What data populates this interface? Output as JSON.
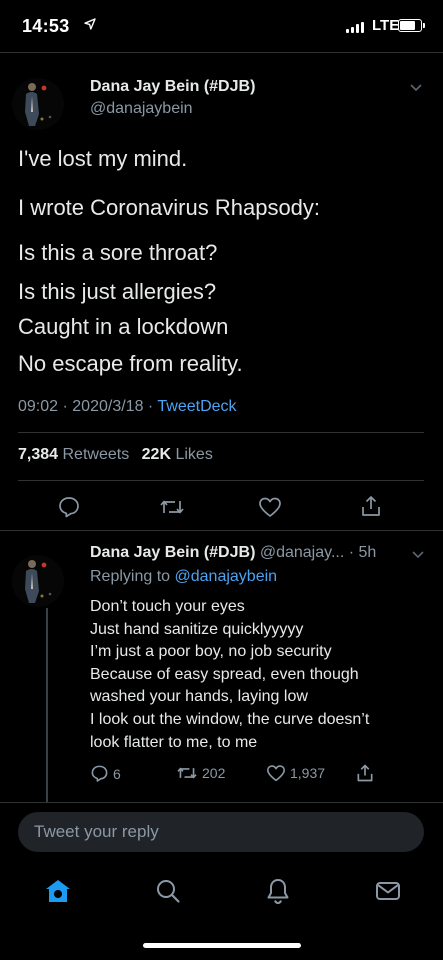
{
  "status_bar": {
    "time": "14:53",
    "network": "LTE",
    "battery_level": 0.8
  },
  "main_tweet": {
    "author_name": "Dana Jay Bein (#DJB)",
    "author_handle": "@danajaybein",
    "lines": [
      "I've lost my mind.",
      "I wrote Coronavirus Rhapsody:",
      "Is this a sore throat?",
      "Is this just allergies?",
      "Caught in a lockdown",
      "No escape from reality."
    ],
    "time": "09:02",
    "date": "2020/3/18",
    "separator": "·",
    "source": "TweetDeck",
    "retweets_count": "7,384",
    "retweets_label": "Retweets",
    "likes_count": "22K",
    "likes_label": "Likes"
  },
  "reply_tweet": {
    "author_name": "Dana Jay Bein (#DJB)",
    "author_handle": "@danajay...",
    "time_ago": "· 5h",
    "replying_to_label": "Replying to",
    "replying_to_handle": "@danajaybein",
    "lines": [
      "Don’t touch your eyes",
      "Just hand sanitize quicklyyyyy",
      "I’m just a poor boy, no job security",
      "Because of easy spread, even though",
      "washed your hands, laying low",
      "I look out the window, the curve doesn’t",
      "look flatter to me, to me"
    ],
    "reply_count": "6",
    "retweet_count": "202",
    "like_count": "1,937"
  },
  "compose": {
    "placeholder": "Tweet your reply"
  },
  "tab_bar": {
    "active": "home",
    "tabs": [
      "home-icon",
      "search-icon",
      "notifications-icon",
      "messages-icon"
    ]
  },
  "colors": {
    "accent": "#1d9bf0",
    "link": "#4ba3f2",
    "muted": "#8b98a5",
    "background": "#000000"
  }
}
